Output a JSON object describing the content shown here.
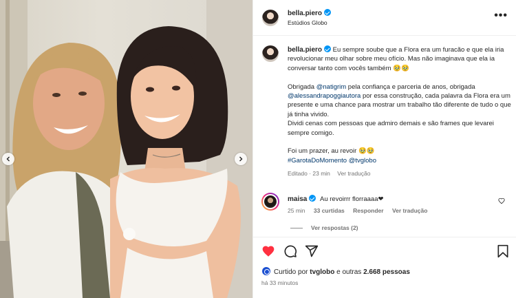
{
  "post": {
    "username": "bella.piero",
    "location": "Estúdios Globo",
    "more_label": "•••"
  },
  "caption": {
    "username": "bella.piero",
    "p1": "Eu sempre soube que a Flora era um furacão e que ela iria revolucionar meu olhar sobre meu ofício. Mas não imaginava que ela ia conversar tanto com vocês também 🥹🥹",
    "p2_a": "Obrigada ",
    "p2_mention1": "@natigrim",
    "p2_b": " pela confiança e parceria de anos, obrigada ",
    "p2_mention2": "@alessandrapoggiautora",
    "p2_c": " por essa construção, cada palavra da Flora era um presente e uma chance para mostrar um trabalho tão diferente de tudo o que já tinha vivido.",
    "p2_d": "Dividi cenas com pessoas que admiro demais e são frames que levarei sempre comigo.",
    "p3_a": "Foi um prazer, au revoir 🥹🥹",
    "hashtag": "#GarotaDoMomento",
    "p3_mention": "@tvglobo",
    "meta_edited": "Editado · 23 min",
    "meta_translate": "Ver tradução"
  },
  "comment": {
    "username": "maisa",
    "text": "Au revoirrr florraaaa❤",
    "time": "25 min",
    "likes": "33 curtidas",
    "reply": "Responder",
    "translate": "Ver tradução",
    "replies": "Ver respostas (2)"
  },
  "footer": {
    "liked_by_prefix": "Curtido por ",
    "liked_by_user": "tvglobo",
    "liked_by_suffix": " e outras ",
    "liked_count": "2.668 pessoas",
    "time_ago": "há 33 minutos"
  },
  "icons": {
    "like": "heart-filled-icon",
    "comment": "comment-icon",
    "share": "share-icon",
    "save": "bookmark-icon"
  },
  "colors": {
    "like_red": "#ff3040",
    "verified_blue": "#0095f6",
    "mention_blue": "#00376b",
    "muted": "#737373"
  }
}
